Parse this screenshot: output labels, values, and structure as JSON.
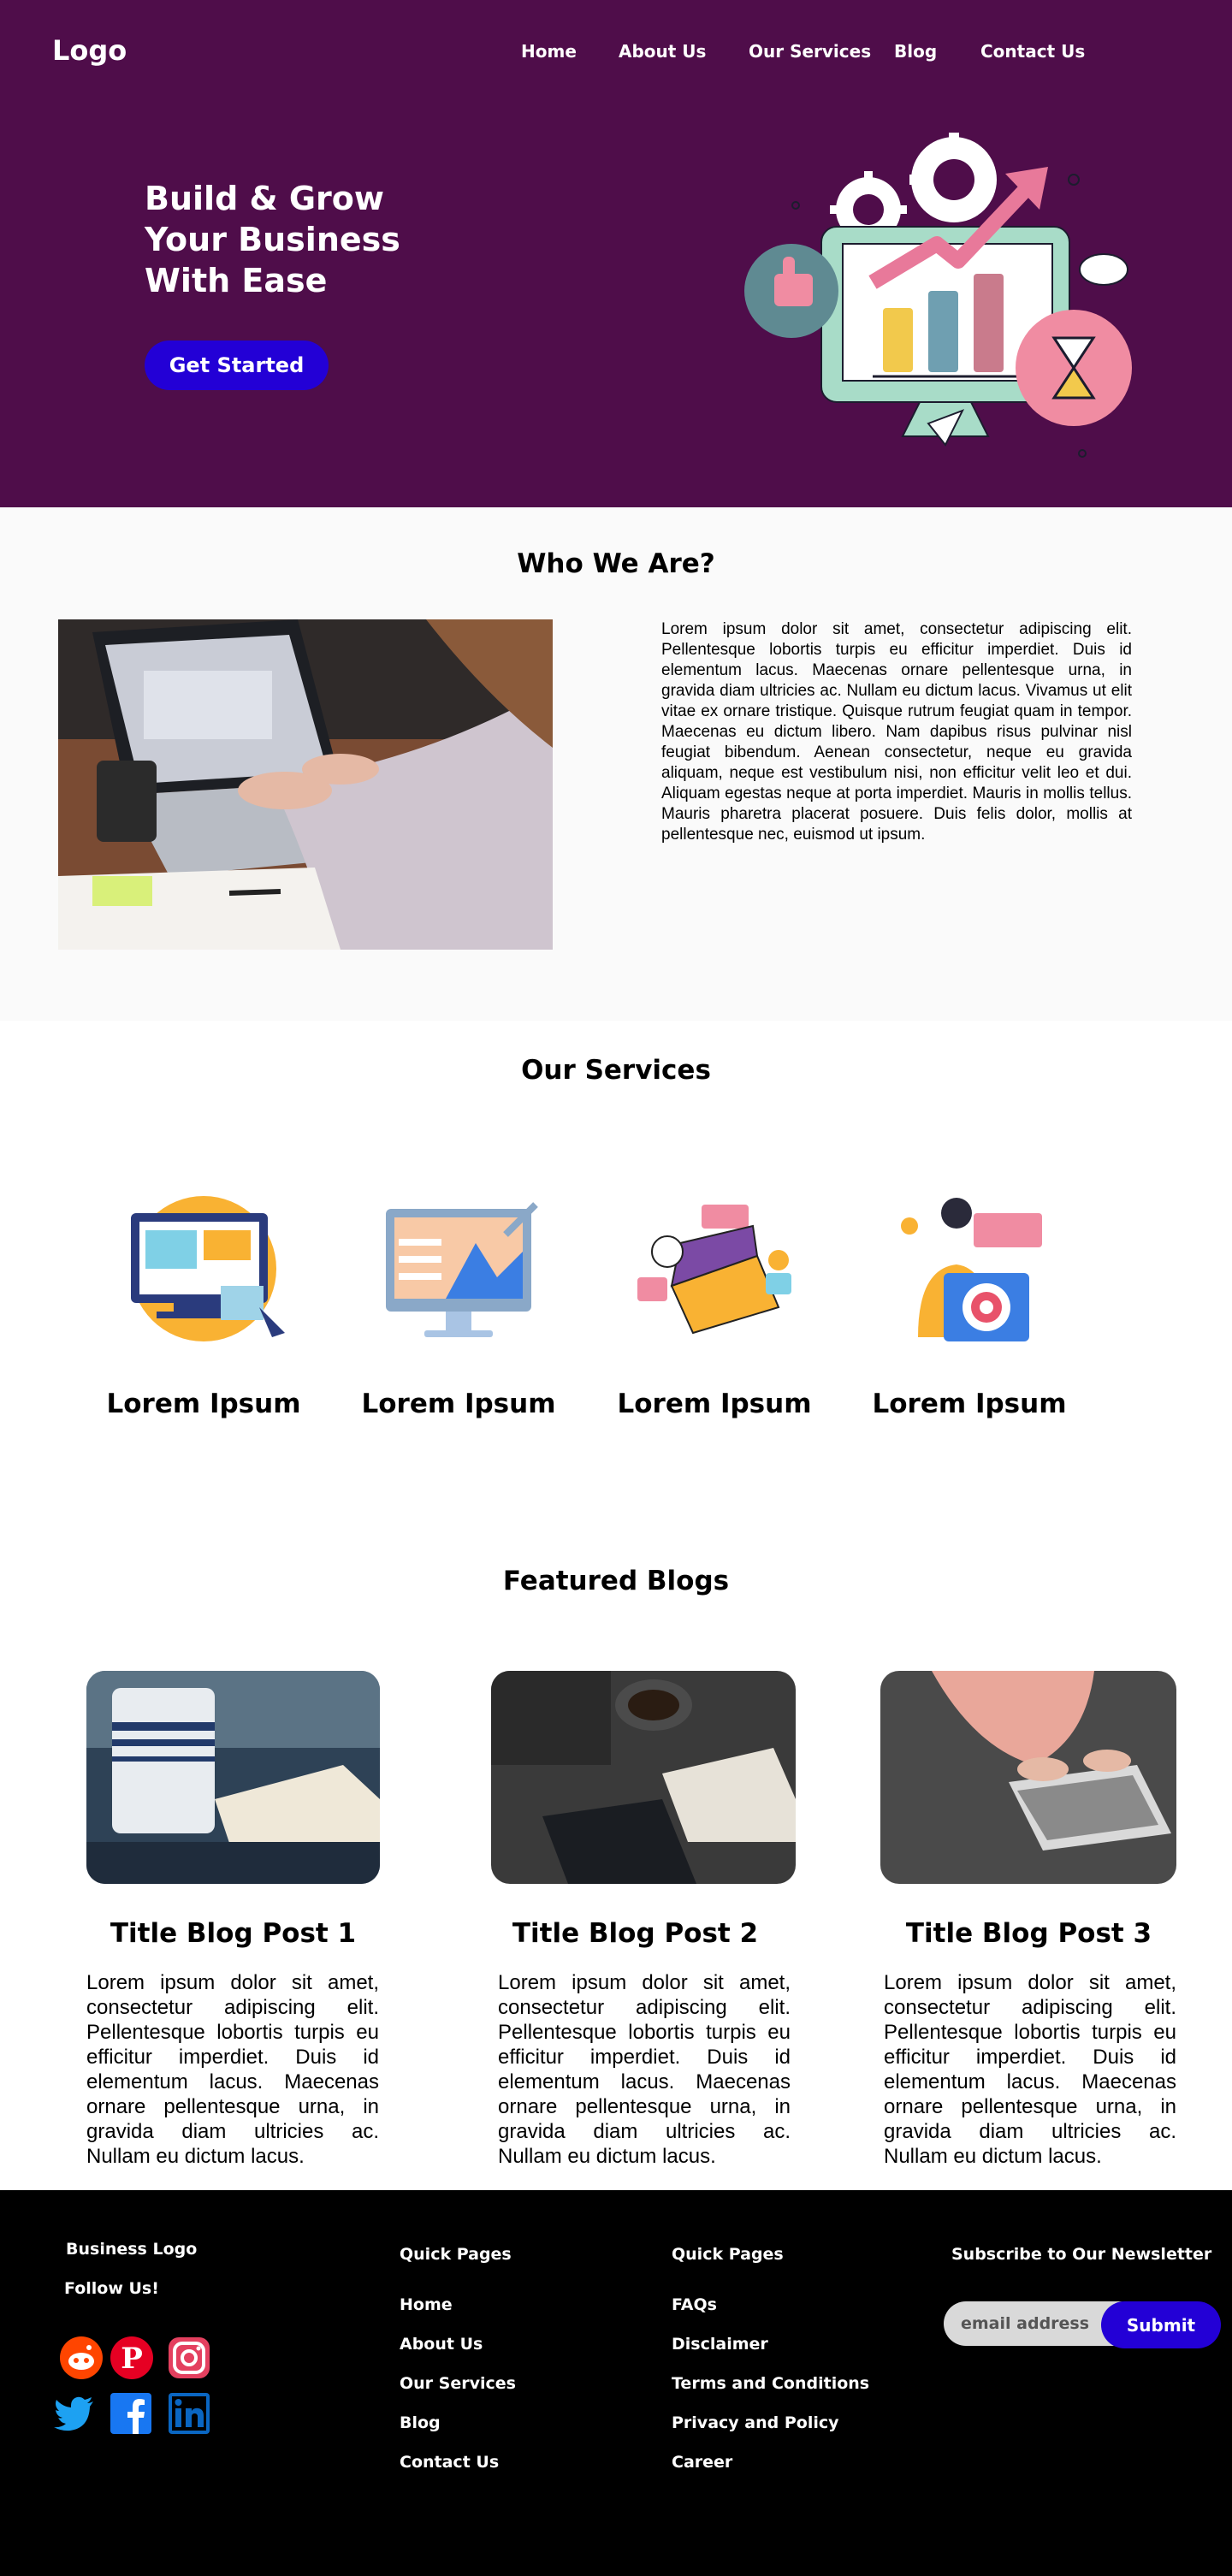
{
  "header": {
    "logo": "Logo",
    "nav": [
      "Home",
      "About Us",
      "Our Services",
      "Blog",
      "Contact Us"
    ]
  },
  "hero": {
    "title": "Build & Grow Your Business With Ease",
    "cta": "Get Started"
  },
  "who": {
    "title": "Who We Are?",
    "text": "Lorem ipsum dolor sit amet, consectetur adipiscing elit. Pellentesque lobortis turpis eu efficitur imperdiet. Duis id elementum lacus. Maecenas ornare pellentesque urna, in gravida diam ultricies ac. Nullam eu dictum lacus. Vivamus ut elit vitae ex ornare tristique. Quisque rutrum feugiat quam in tempor. Maecenas eu dictum libero. Nam dapibus risus pulvinar nisl feugiat bibendum. Aenean consectetur, neque eu gravida aliquam, neque est vestibulum nisi, non efficitur velit leo et dui. Aliquam egestas neque at porta imperdiet. Mauris in mollis tellus. Mauris pharetra placerat posuere. Duis felis dolor, mollis at pellentesque nec, euismod ut ipsum."
  },
  "services": {
    "title": "Our Services",
    "items": [
      {
        "label": "Lorem Ipsum",
        "icon": "web-design-icon"
      },
      {
        "label": "Lorem Ipsum",
        "icon": "analytics-monitor-icon"
      },
      {
        "label": "Lorem Ipsum",
        "icon": "marketing-laptop-icon"
      },
      {
        "label": "Lorem Ipsum",
        "icon": "business-target-icon"
      }
    ]
  },
  "blogs": {
    "title": "Featured Blogs",
    "posts": [
      {
        "title": "Title Blog Post 1",
        "text": "Lorem ipsum dolor sit amet, consectetur adipiscing elit. Pellentesque lobortis turpis eu efficitur imperdiet. Duis id elementum lacus. Maecenas ornare pellentesque urna, in gravida diam ultricies ac. Nullam eu dictum lacus."
      },
      {
        "title": "Title Blog Post 2",
        "text": "Lorem ipsum dolor sit amet, consectetur adipiscing elit. Pellentesque lobortis turpis eu efficitur imperdiet. Duis id elementum lacus. Maecenas ornare pellentesque urna, in gravida diam ultricies ac. Nullam eu dictum lacus."
      },
      {
        "title": "Title Blog Post 3",
        "text": "Lorem ipsum dolor sit amet, consectetur adipiscing elit. Pellentesque lobortis turpis eu efficitur imperdiet. Duis id elementum lacus. Maecenas ornare pellentesque urna, in gravida diam ultricies ac. Nullam eu dictum lacus."
      }
    ]
  },
  "footer": {
    "business_logo": "Business Logo",
    "follow": "Follow Us!",
    "socials": [
      "reddit-icon",
      "pinterest-icon",
      "instagram-icon",
      "twitter-icon",
      "facebook-icon",
      "linkedin-icon"
    ],
    "col1": {
      "title": "Quick Pages",
      "links": [
        "Home",
        "About Us",
        "Our Services",
        "Blog",
        "Contact Us"
      ]
    },
    "col2": {
      "title": "Quick Pages",
      "links": [
        "FAQs",
        "Disclaimer",
        "Terms and Conditions",
        "Privacy and Policy",
        "Career"
      ]
    },
    "newsletter": {
      "title": "Subscribe to Our Newsletter",
      "placeholder": "email address",
      "submit": "Submit"
    }
  },
  "colors": {
    "hero_bg": "#4f0d4a",
    "accent": "#2300d6",
    "footer_bg": "#000000"
  }
}
